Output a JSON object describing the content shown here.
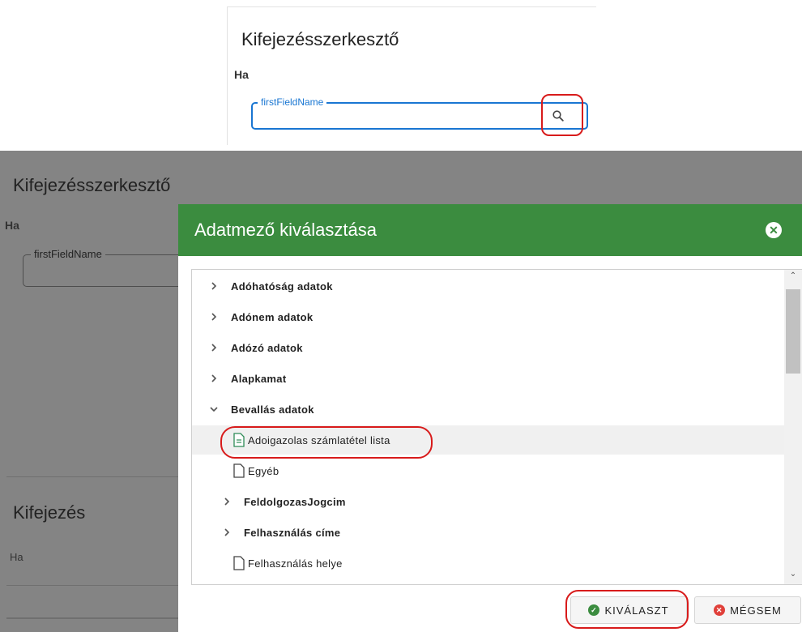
{
  "top_panel": {
    "title": "Kifejezésszerkesztő",
    "condition_label": "Ha",
    "field_label": "firstFieldName",
    "search_icon": "search-icon"
  },
  "background": {
    "title": "Kifejezésszerkesztő",
    "condition_label": "Ha",
    "field_label": "firstFieldName",
    "expression_title": "Kifejezés",
    "expression_condition": "Ha"
  },
  "dialog": {
    "title": "Adatmező kiválasztása",
    "header_color": "#3b8c3f",
    "tree": [
      {
        "label": "Adóhatóság adatok",
        "type": "group",
        "expanded": false,
        "indent": 0
      },
      {
        "label": "Adónem adatok",
        "type": "group",
        "expanded": false,
        "indent": 0
      },
      {
        "label": "Adózó adatok",
        "type": "group",
        "expanded": false,
        "indent": 0
      },
      {
        "label": "Alapkamat",
        "type": "group",
        "expanded": false,
        "indent": 0
      },
      {
        "label": "Bevallás adatok",
        "type": "group",
        "expanded": true,
        "indent": 0
      },
      {
        "label": "Adoigazolas számlatétel lista",
        "type": "leaf",
        "selected": true,
        "indent": 1
      },
      {
        "label": "Egyéb",
        "type": "leaf",
        "selected": false,
        "indent": 1
      },
      {
        "label": "FeldolgozasJogcim",
        "type": "group",
        "expanded": false,
        "indent": 1
      },
      {
        "label": "Felhasználás címe",
        "type": "group",
        "expanded": false,
        "indent": 1
      },
      {
        "label": "Felhasználás helye",
        "type": "leaf",
        "selected": false,
        "indent": 1
      }
    ],
    "select_button": "KIVÁLASZT",
    "cancel_button": "MÉGSEM"
  }
}
